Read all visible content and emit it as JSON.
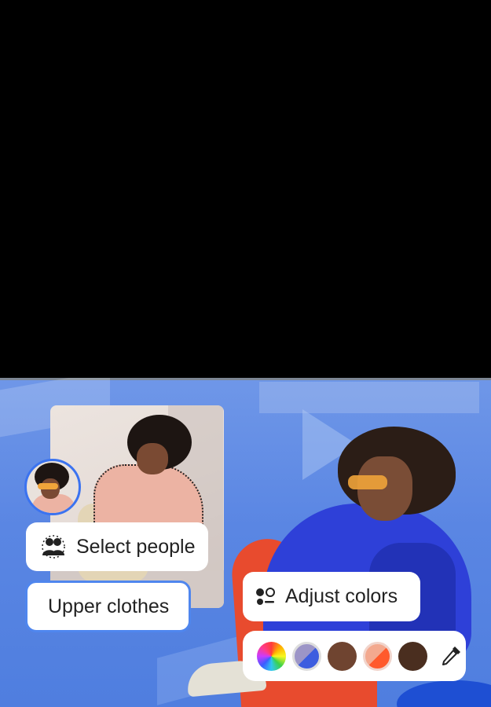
{
  "chips": {
    "select_people": "Select people",
    "upper_clothes": "Upper clothes",
    "adjust_colors": "Adjust colors"
  },
  "icons": {
    "select_people": "select-people-icon",
    "adjust_colors": "adjust-colors-icon",
    "eyedropper": "eyedropper-icon"
  },
  "swatches": [
    {
      "name": "color-wheel",
      "colors": [
        "#ff3b3b",
        "#ffb000",
        "#3bd14b",
        "#2fc7f0",
        "#3b5cff",
        "#c93bff"
      ]
    },
    {
      "name": "lavender-blue",
      "colors": [
        "#9c95c7",
        "#3d5ddf"
      ]
    },
    {
      "name": "medium-brown",
      "colors": [
        "#6f4430"
      ]
    },
    {
      "name": "peach-orange",
      "colors": [
        "#f3a98f",
        "#ff5a2c"
      ]
    },
    {
      "name": "dark-brown",
      "colors": [
        "#4a2e1f"
      ]
    }
  ],
  "colors": {
    "accent": "#3b73f0",
    "background_blue": "#5a86e3",
    "hoodie": "#2e40d8",
    "pants": "#e84b2e"
  }
}
